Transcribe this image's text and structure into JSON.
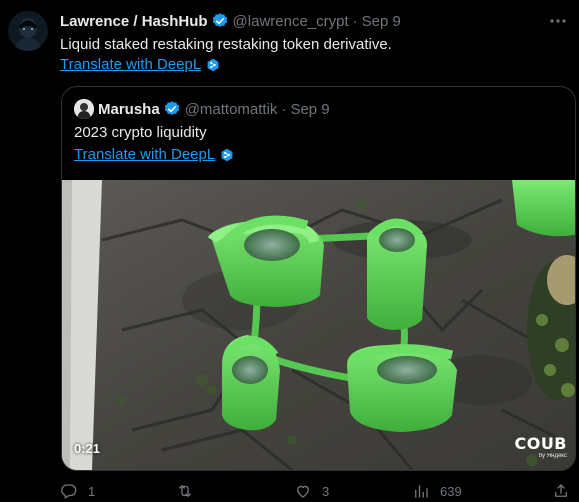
{
  "tweet": {
    "author_name": "Lawrence / HashHub",
    "author_handle": "@lawrence_crypt",
    "separator": "·",
    "date": "Sep 9",
    "text": "Liquid staked restaking restaking token derivative.",
    "translate_label": "Translate with DeepL",
    "icons": {
      "verified": "verified-badge-icon",
      "more": "more-options-icon",
      "deepl": "deepl-icon"
    }
  },
  "quote": {
    "author_name": "Marusha",
    "author_handle": "@mattomattik",
    "separator": "·",
    "date": "Sep 9",
    "text": "2023 crypto liquidity",
    "translate_label": "Translate with DeepL",
    "video": {
      "duration": "0:21",
      "brand": "COUB",
      "brand_sub": "by Яндекс"
    }
  },
  "actions": {
    "reply_count": "1",
    "retweet_count": "",
    "like_count": "3",
    "views_count": "639"
  },
  "colors": {
    "background": "#000000",
    "text": "#e7e9ea",
    "secondary": "#71767b",
    "link": "#1d9bf0",
    "border": "#2f3336",
    "watering_can": "#5fd65a"
  }
}
